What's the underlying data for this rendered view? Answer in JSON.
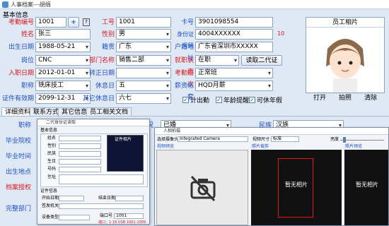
{
  "window": {
    "title": "人事档案---胡绢"
  },
  "section_title": "基本信息",
  "labels": {
    "kq_no": "考勤编号",
    "name": "姓名",
    "birth": "出生日期",
    "post": "岗位",
    "join_date": "入职日期",
    "job_title": "职称",
    "cert_valid": "证件有效期",
    "emp_no": "工号",
    "gender": "性别",
    "native": "籍贯",
    "dept": "部门名称",
    "probation": "转正日期",
    "rest_day": "休息日",
    "other_rest": "其它休息日",
    "card_no": "卡号",
    "id_no": "身份证号码",
    "hukou": "户籍地址",
    "job_status": "就职状态",
    "shift": "考勤班次",
    "salary_set": "薪资帐套"
  },
  "values": {
    "kq_no": "1001",
    "name": "张三",
    "birth": "1988-05-21",
    "post": "CNC",
    "join_date": "2012-01-01",
    "job_title": "铣床技工",
    "cert_valid": "2099-12-31",
    "emp_no": "1001",
    "gender": "男",
    "native": "广东",
    "dept": "销售二部",
    "probation": "",
    "rest_day": "五",
    "other_rest": "六七",
    "card_no": "3901098554",
    "id_no": "4004XXXXXX",
    "id_len": "10",
    "hukou": "广东省深圳市XXXXX",
    "job_status": "在职",
    "shift": "正常班",
    "salary_set": "HQD月薪"
  },
  "buttons": {
    "read_id": "读取二代证",
    "open": "打开",
    "take": "拍照",
    "clear": "清除"
  },
  "photo_caption": "员工相片",
  "checks": {
    "calc_attendance": "计出勤",
    "annual_remind": "年龄提醒",
    "annual_leave": "可休年假"
  },
  "tabs": [
    "详细资料",
    "联系方式",
    "其它信息",
    "员工相关文档"
  ],
  "lower": {
    "rank": "职称",
    "grad_school": "毕业院校",
    "grad_time": "毕业时间",
    "origin": "出生地点",
    "archive": "档案授权",
    "full_dept": "完整部门",
    "marital_suffix": "况",
    "marital_value": "已婚",
    "nation": "民族",
    "nation_value": "汉族"
  },
  "id_reader_window": {
    "title": "二代身份证读取",
    "section": "基本信息",
    "fields": [
      "姓名",
      "性别",
      "民族",
      "生日",
      "号码",
      "住址"
    ],
    "photo_label": "证件相片",
    "cert_section": "证件信息",
    "start_date": "开始日期",
    "end_date": "结束日期",
    "issuer": "签发机关",
    "device_type": "设备类型",
    "port": "端口号",
    "port_value": "1001",
    "port_note": "端口：1-16 USB 1001-1009"
  },
  "camera_window": {
    "title": "人相拍摄",
    "select_camera": "选择摄像头",
    "camera": "Integrated Camera",
    "resolution": "视频尺寸",
    "res_value": "标准",
    "brightness": "亮度",
    "video_preview": "视频预览",
    "photo_crop": "照片裁剪",
    "photo_preview": "照片预览",
    "no_photo": "暂无相片"
  }
}
